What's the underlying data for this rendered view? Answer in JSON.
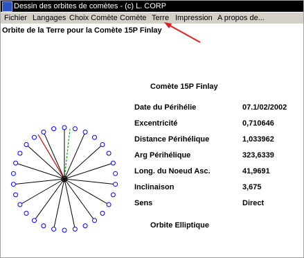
{
  "window": {
    "title": "Dessin des orbites de comètes - (c) L. CORP",
    "icon": "app-icon"
  },
  "menu": [
    {
      "label": "Fichier"
    },
    {
      "label": "Langages"
    },
    {
      "label": "Choix Comète"
    },
    {
      "label": "Comète"
    },
    {
      "label": "Terre"
    },
    {
      "label": "Impression"
    },
    {
      "label": "A propos de..."
    }
  ],
  "content": {
    "heading": "Orbite de la Terre pour la Comète 15P Finlay",
    "info_title": "Comète 15P Finlay",
    "rows": [
      {
        "label": "Date du Périhélie",
        "value": "07.1/02/2002"
      },
      {
        "label": "Excentricité",
        "value": "0,710646"
      },
      {
        "label": "Distance Périhélique",
        "value": "1,033962"
      },
      {
        "label": "Arg Périhélique",
        "value": "323,6339"
      },
      {
        "label": "Long. du Noeud Asc.",
        "value": "41,9691"
      },
      {
        "label": "Inclinaison",
        "value": "3,675"
      },
      {
        "label": "Sens",
        "value": "Direct"
      }
    ],
    "orbit_type": "Orbite Elliptique"
  },
  "colors": {
    "titlebar": "#000000",
    "menubar": "#d4d0c8",
    "orbit_circles": "#0000ff",
    "spokes": "#000000",
    "red_line": "#cc0000",
    "green_line": "#00aa00",
    "arrow": "#e02020"
  },
  "icons": {
    "sun": "sun-marker",
    "arrow": "annotation-arrow"
  }
}
